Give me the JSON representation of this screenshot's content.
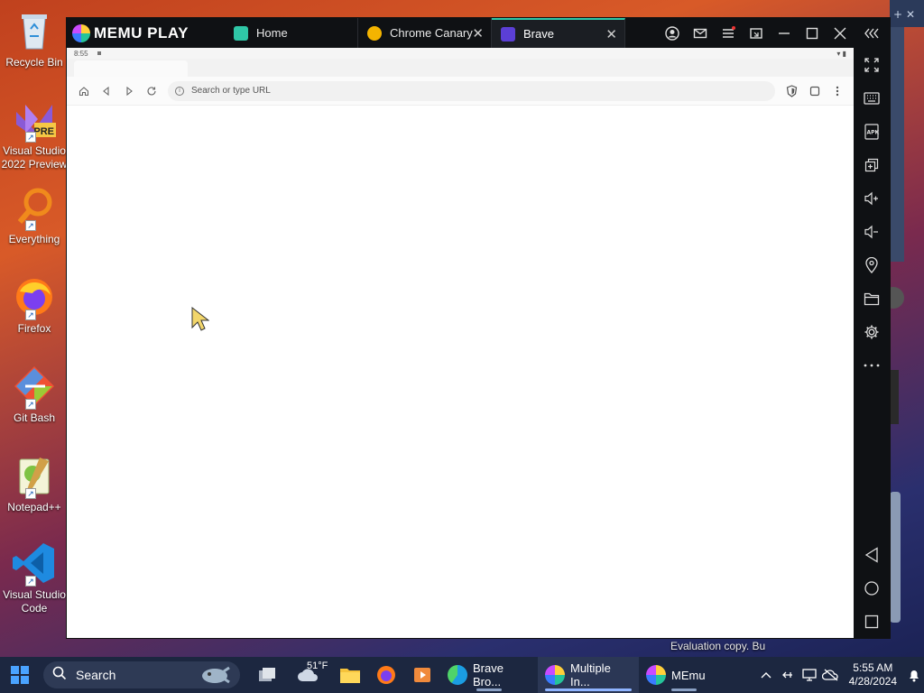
{
  "desktop": {
    "icons": [
      {
        "label": "Recycle Bin"
      },
      {
        "label": "Visual Studio 2022 Preview",
        "badge": "PRE"
      },
      {
        "label": "Everything"
      },
      {
        "label": "Firefox"
      },
      {
        "label": "Git Bash"
      },
      {
        "label": "Notepad++"
      },
      {
        "label": "Visual Studio Code"
      }
    ],
    "eval_text": "Evaluation copy. Bu"
  },
  "emulator": {
    "brand": "MEMU PLAY",
    "tabs": [
      {
        "label": "Home",
        "icon": "memu-home-icon",
        "color": "#2fc7a7"
      },
      {
        "label": "Chrome Canary",
        "icon": "chrome-canary-icon",
        "color": "#f4b400"
      },
      {
        "label": "Brave",
        "icon": "brave-icon",
        "color": "#5b3fd6",
        "active": true
      }
    ],
    "android": {
      "status_time": "8:55",
      "url_placeholder": "Search or type URL"
    },
    "colors": {
      "titlebar": "#0f1114",
      "accent": "#2fc7a7"
    }
  },
  "taskbar": {
    "search_placeholder": "Search",
    "weather": "51°F",
    "apps": [
      {
        "label": "Brave Bro...",
        "icon": "edge-icon"
      },
      {
        "label": "Multiple In...",
        "icon": "memu-multi-icon",
        "active": true
      },
      {
        "label": "MEmu",
        "icon": "memu-icon"
      }
    ],
    "clock": {
      "time": "5:55 AM",
      "date": "4/28/2024"
    }
  }
}
